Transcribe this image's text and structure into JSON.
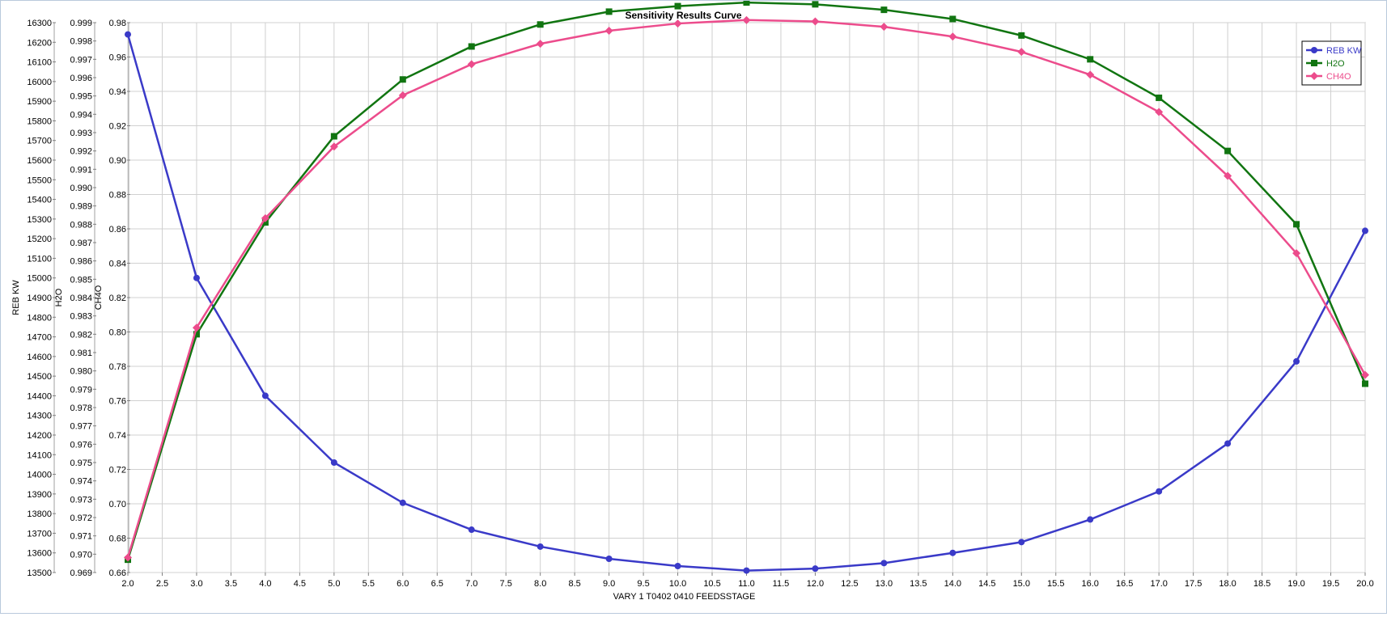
{
  "chart_data": {
    "type": "line",
    "title": "Sensitivity Results Curve",
    "xlabel": "VARY  1 T0402 0410 FEEDSSTAGE",
    "xlim": [
      2.0,
      20.0
    ],
    "x_tick_step": 0.5,
    "x": [
      2.0,
      3.0,
      4.0,
      5.0,
      6.0,
      7.0,
      8.0,
      9.0,
      10.0,
      11.0,
      12.0,
      13.0,
      14.0,
      15.0,
      16.0,
      17.0,
      18.0,
      19.0,
      20.0
    ],
    "axes": [
      {
        "id": "reb",
        "label": "REB KW",
        "ylim": [
          13500,
          16300
        ],
        "tick_step": 100,
        "tick_decimals": 0
      },
      {
        "id": "h2o",
        "label": "H2O",
        "ylim": [
          0.969,
          0.999
        ],
        "tick_step": 0.001,
        "tick_decimals": 3
      },
      {
        "id": "ch4o",
        "label": "CH4O",
        "ylim": [
          0.66,
          0.98
        ],
        "tick_step": 0.02,
        "tick_decimals": 2
      }
    ],
    "series": [
      {
        "name": "REB KW",
        "axis": "reb",
        "color": "#3a3ac8",
        "marker": "circle",
        "values": [
          16240,
          15000,
          14400,
          14060,
          13855,
          13718,
          13632,
          13570,
          13533,
          13510,
          13520,
          13548,
          13600,
          13655,
          13770,
          13913,
          14157,
          14575,
          15240
        ]
      },
      {
        "name": "H2O",
        "axis": "h2o",
        "color": "#117511",
        "marker": "square",
        "values": [
          0.9697,
          0.982,
          0.9881,
          0.9928,
          0.9959,
          0.9977,
          0.9989,
          0.9996,
          0.9999,
          1.0001,
          1.0,
          0.9997,
          0.9992,
          0.9983,
          0.997,
          0.9949,
          0.992,
          0.988,
          0.9793
        ]
      },
      {
        "name": "CH4O",
        "axis": "ch4o",
        "color": "#ec4c8c",
        "marker": "diamond",
        "values": [
          0.6687,
          0.8025,
          0.8662,
          0.9079,
          0.9377,
          0.9558,
          0.9677,
          0.9753,
          0.9795,
          0.9815,
          0.9807,
          0.9776,
          0.9719,
          0.963,
          0.9497,
          0.928,
          0.8908,
          0.8458,
          0.775
        ]
      }
    ],
    "legend_position": "top-right",
    "grid": true
  }
}
